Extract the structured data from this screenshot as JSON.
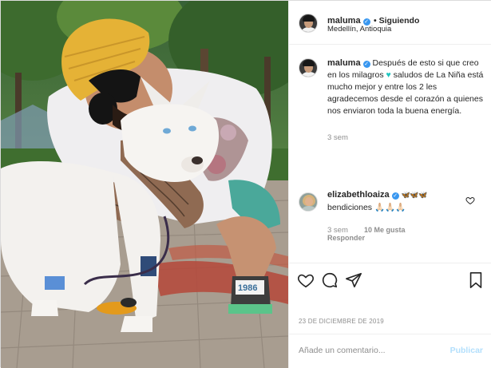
{
  "post": {
    "author": "maluma",
    "follow_status": "• Siguiendo",
    "location": "Medellín, Antioquia",
    "caption_part1": "Después de esto si que creo en los milagros ",
    "caption_heart": "♥",
    "caption_part2": " saludos de La Niña está mucho mejor y entre los 2 les agradecemos desde el corazón a quienes nos enviaron toda la buena energía.",
    "caption_time": "3 sem",
    "date": "23 DE DICIEMBRE DE 2019"
  },
  "comment": {
    "author": "elizabethloaiza",
    "author_extra": "🦋🦋🦋",
    "text": "bendiciones 🙏🏻🙏🏻🙏🏻",
    "time": "3 sem",
    "likes": "10 Me gusta",
    "reply": "Responder"
  },
  "composer": {
    "placeholder": "Añade un comentario...",
    "publish": "Publicar"
  },
  "colors": {
    "verified": "#3897f0",
    "accent_disabled": "#b2dffc",
    "caption_heart": "#1ec6c0"
  },
  "icons": {
    "like": "heart-outline-icon",
    "comment": "comment-bubble-icon",
    "share": "paper-plane-icon",
    "save": "bookmark-icon"
  }
}
